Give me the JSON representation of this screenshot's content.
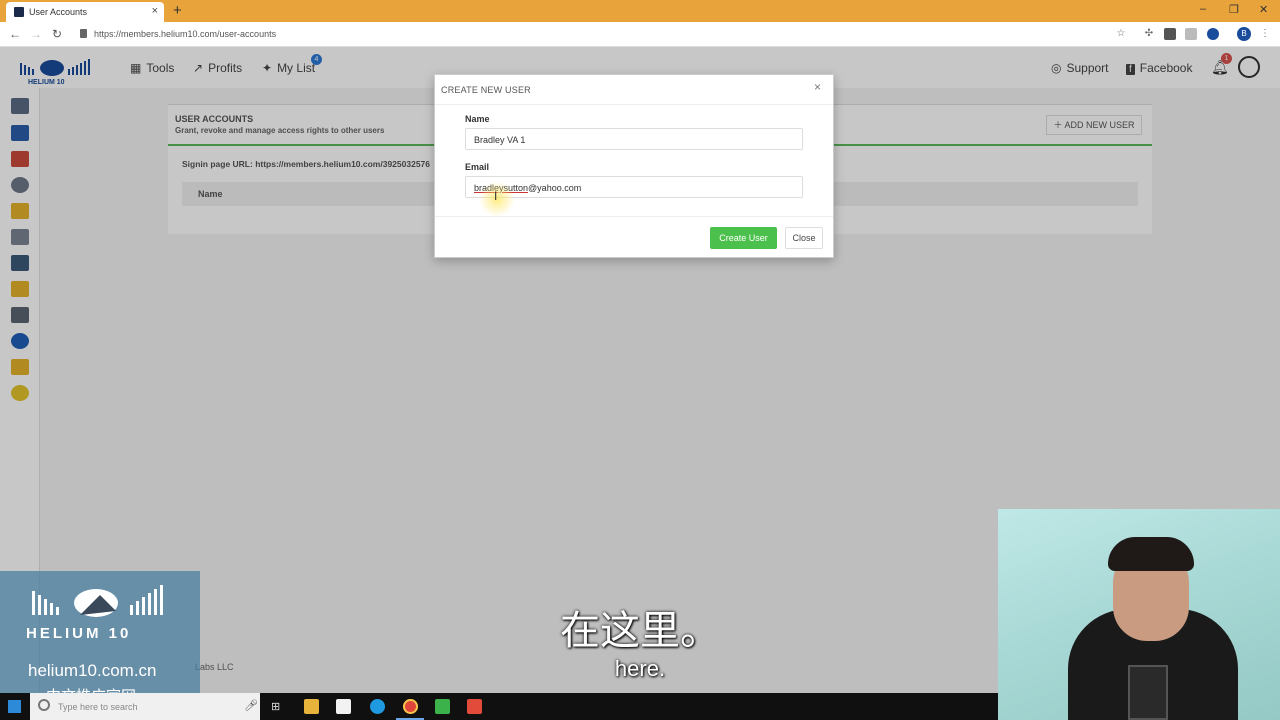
{
  "browser": {
    "tab_title": "User Accounts",
    "tab_close": "×",
    "new_tab": "+",
    "url": "https://members.helium10.com/user-accounts",
    "profile_initial": "B",
    "window_controls": [
      "–",
      "❐",
      "✕"
    ]
  },
  "header": {
    "nav": [
      {
        "label": "Tools",
        "icon": "grid-icon"
      },
      {
        "label": "Profits",
        "icon": "chart-icon"
      },
      {
        "label": "My List",
        "icon": "pin-icon",
        "badge": "4"
      }
    ],
    "support_label": "Support",
    "facebook_label": "Facebook",
    "notification_badge": "1"
  },
  "page": {
    "section_title": "USER ACCOUNTS",
    "section_subtitle": "Grant, revoke and manage access rights to other users",
    "add_user_button": "ADD NEW USER",
    "signin_url_text": "Signin page URL: https://members.helium10.com/3925032576",
    "table_header_name": "Name",
    "footer_fragment": "Labs LLC"
  },
  "modal": {
    "title": "CREATE NEW USER",
    "close_icon": "×",
    "name_label": "Name",
    "name_value": "Bradley VA 1",
    "email_label": "Email",
    "email_value_underlined": "bradleysutton",
    "email_value_rest": "@yahoo.com",
    "create_button": "Create User",
    "close_button": "Close"
  },
  "watermark": {
    "logo_text": "HELIUM 10",
    "url": "helium10.com.cn",
    "tagline": "中文推广官网"
  },
  "subtitles": {
    "chinese": "在这里。",
    "english": "here."
  },
  "taskbar": {
    "search_placeholder": "Type here to search"
  },
  "colors": {
    "browser_tabbar": "#e8a33a",
    "create_button": "#4cc04c",
    "green_accent": "#5cb85c",
    "brand_blue": "#1a4c9c"
  }
}
